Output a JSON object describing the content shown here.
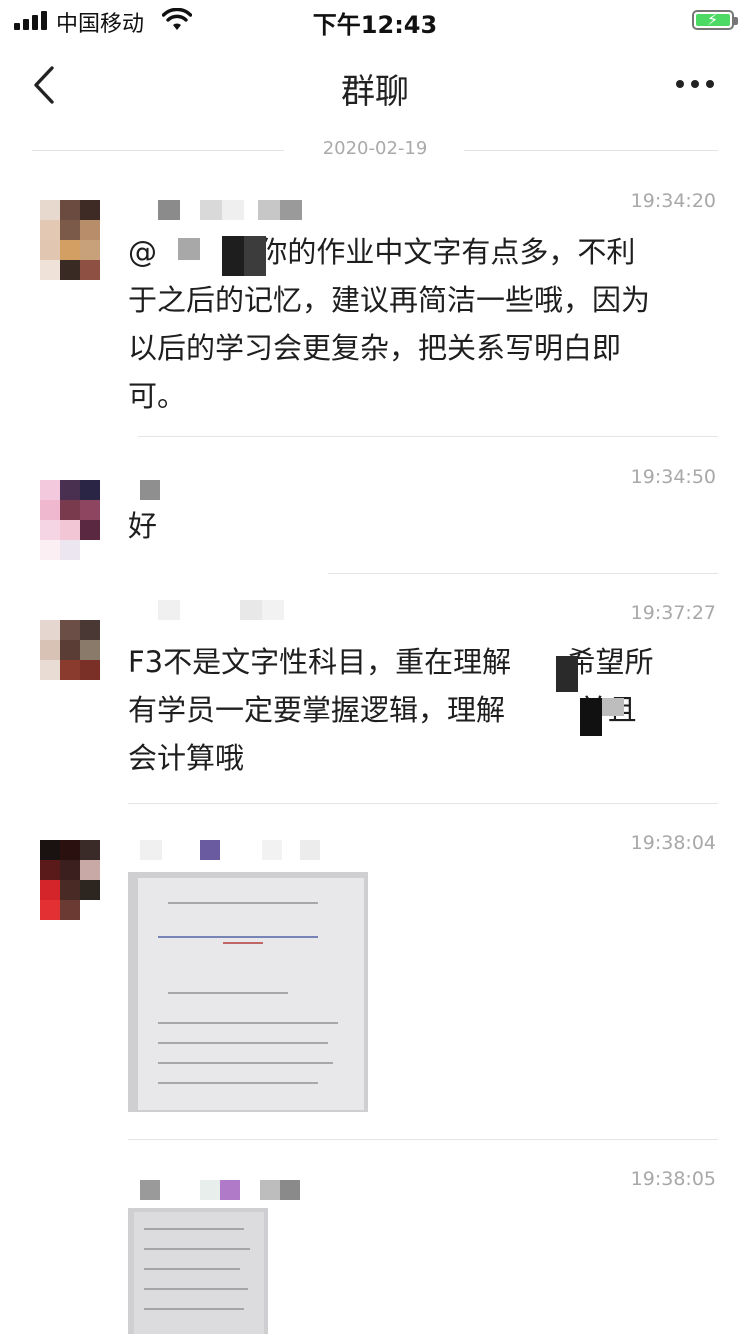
{
  "status_bar": {
    "carrier": "中国移动",
    "time": "下午12:43"
  },
  "nav": {
    "title": "群聊"
  },
  "date_divider": "2020-02-19",
  "messages": [
    {
      "time": "19:34:20",
      "lines": [
        "@           你的作业中文字有点多，不利",
        "于之后的记忆，建议再简洁一些哦，因为",
        "以后的学习会更复杂，把关系写明白即",
        "可。"
      ]
    },
    {
      "time": "19:34:50",
      "lines": [
        "好"
      ]
    },
    {
      "time": "19:37:27",
      "lines": [
        "F3不是文字性科目，重在理解      希望所",
        "有学员一定要掌握逻辑，理解        并且",
        "会计算哦"
      ]
    },
    {
      "time": "19:38:04"
    },
    {
      "time": "19:38:05"
    }
  ],
  "colors": {
    "time_text": "#a8a8a8",
    "separator": "#e5e5e5",
    "battery": "#4cd964"
  },
  "icons": {
    "back": "chevron-left-icon",
    "more": "more-dots-icon",
    "wifi": "wifi-icon",
    "signal": "signal-bars-icon",
    "battery": "battery-charging-icon"
  }
}
